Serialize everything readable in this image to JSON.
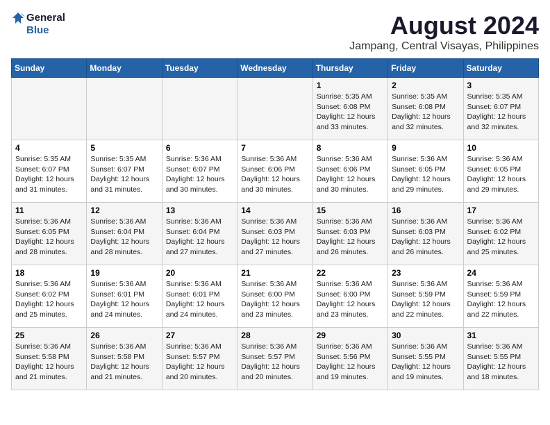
{
  "logo": {
    "line1": "General",
    "line2": "Blue"
  },
  "title": "August 2024",
  "subtitle": "Jampang, Central Visayas, Philippines",
  "weekdays": [
    "Sunday",
    "Monday",
    "Tuesday",
    "Wednesday",
    "Thursday",
    "Friday",
    "Saturday"
  ],
  "weeks": [
    [
      {
        "day": "",
        "info": ""
      },
      {
        "day": "",
        "info": ""
      },
      {
        "day": "",
        "info": ""
      },
      {
        "day": "",
        "info": ""
      },
      {
        "day": "1",
        "info": "Sunrise: 5:35 AM\nSunset: 6:08 PM\nDaylight: 12 hours\nand 33 minutes."
      },
      {
        "day": "2",
        "info": "Sunrise: 5:35 AM\nSunset: 6:08 PM\nDaylight: 12 hours\nand 32 minutes."
      },
      {
        "day": "3",
        "info": "Sunrise: 5:35 AM\nSunset: 6:07 PM\nDaylight: 12 hours\nand 32 minutes."
      }
    ],
    [
      {
        "day": "4",
        "info": "Sunrise: 5:35 AM\nSunset: 6:07 PM\nDaylight: 12 hours\nand 31 minutes."
      },
      {
        "day": "5",
        "info": "Sunrise: 5:35 AM\nSunset: 6:07 PM\nDaylight: 12 hours\nand 31 minutes."
      },
      {
        "day": "6",
        "info": "Sunrise: 5:36 AM\nSunset: 6:07 PM\nDaylight: 12 hours\nand 30 minutes."
      },
      {
        "day": "7",
        "info": "Sunrise: 5:36 AM\nSunset: 6:06 PM\nDaylight: 12 hours\nand 30 minutes."
      },
      {
        "day": "8",
        "info": "Sunrise: 5:36 AM\nSunset: 6:06 PM\nDaylight: 12 hours\nand 30 minutes."
      },
      {
        "day": "9",
        "info": "Sunrise: 5:36 AM\nSunset: 6:05 PM\nDaylight: 12 hours\nand 29 minutes."
      },
      {
        "day": "10",
        "info": "Sunrise: 5:36 AM\nSunset: 6:05 PM\nDaylight: 12 hours\nand 29 minutes."
      }
    ],
    [
      {
        "day": "11",
        "info": "Sunrise: 5:36 AM\nSunset: 6:05 PM\nDaylight: 12 hours\nand 28 minutes."
      },
      {
        "day": "12",
        "info": "Sunrise: 5:36 AM\nSunset: 6:04 PM\nDaylight: 12 hours\nand 28 minutes."
      },
      {
        "day": "13",
        "info": "Sunrise: 5:36 AM\nSunset: 6:04 PM\nDaylight: 12 hours\nand 27 minutes."
      },
      {
        "day": "14",
        "info": "Sunrise: 5:36 AM\nSunset: 6:03 PM\nDaylight: 12 hours\nand 27 minutes."
      },
      {
        "day": "15",
        "info": "Sunrise: 5:36 AM\nSunset: 6:03 PM\nDaylight: 12 hours\nand 26 minutes."
      },
      {
        "day": "16",
        "info": "Sunrise: 5:36 AM\nSunset: 6:03 PM\nDaylight: 12 hours\nand 26 minutes."
      },
      {
        "day": "17",
        "info": "Sunrise: 5:36 AM\nSunset: 6:02 PM\nDaylight: 12 hours\nand 25 minutes."
      }
    ],
    [
      {
        "day": "18",
        "info": "Sunrise: 5:36 AM\nSunset: 6:02 PM\nDaylight: 12 hours\nand 25 minutes."
      },
      {
        "day": "19",
        "info": "Sunrise: 5:36 AM\nSunset: 6:01 PM\nDaylight: 12 hours\nand 24 minutes."
      },
      {
        "day": "20",
        "info": "Sunrise: 5:36 AM\nSunset: 6:01 PM\nDaylight: 12 hours\nand 24 minutes."
      },
      {
        "day": "21",
        "info": "Sunrise: 5:36 AM\nSunset: 6:00 PM\nDaylight: 12 hours\nand 23 minutes."
      },
      {
        "day": "22",
        "info": "Sunrise: 5:36 AM\nSunset: 6:00 PM\nDaylight: 12 hours\nand 23 minutes."
      },
      {
        "day": "23",
        "info": "Sunrise: 5:36 AM\nSunset: 5:59 PM\nDaylight: 12 hours\nand 22 minutes."
      },
      {
        "day": "24",
        "info": "Sunrise: 5:36 AM\nSunset: 5:59 PM\nDaylight: 12 hours\nand 22 minutes."
      }
    ],
    [
      {
        "day": "25",
        "info": "Sunrise: 5:36 AM\nSunset: 5:58 PM\nDaylight: 12 hours\nand 21 minutes."
      },
      {
        "day": "26",
        "info": "Sunrise: 5:36 AM\nSunset: 5:58 PM\nDaylight: 12 hours\nand 21 minutes."
      },
      {
        "day": "27",
        "info": "Sunrise: 5:36 AM\nSunset: 5:57 PM\nDaylight: 12 hours\nand 20 minutes."
      },
      {
        "day": "28",
        "info": "Sunrise: 5:36 AM\nSunset: 5:57 PM\nDaylight: 12 hours\nand 20 minutes."
      },
      {
        "day": "29",
        "info": "Sunrise: 5:36 AM\nSunset: 5:56 PM\nDaylight: 12 hours\nand 19 minutes."
      },
      {
        "day": "30",
        "info": "Sunrise: 5:36 AM\nSunset: 5:55 PM\nDaylight: 12 hours\nand 19 minutes."
      },
      {
        "day": "31",
        "info": "Sunrise: 5:36 AM\nSunset: 5:55 PM\nDaylight: 12 hours\nand 18 minutes."
      }
    ]
  ]
}
